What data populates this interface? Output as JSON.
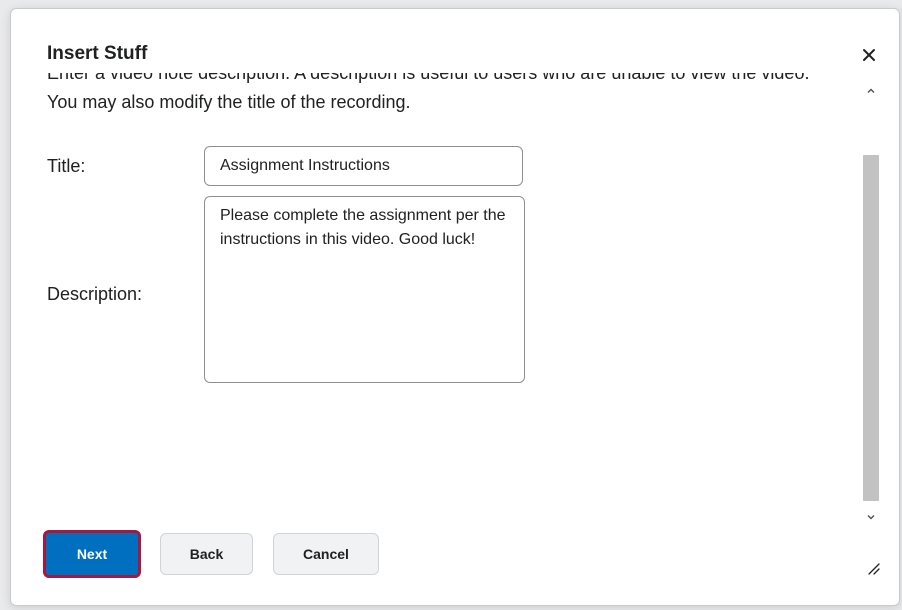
{
  "dialog": {
    "title": "Insert Stuff",
    "close_icon": "close-icon"
  },
  "content": {
    "intro_text": "Enter a video note description. A description is useful to users who are unable to view the video. You may also modify the title of the recording.",
    "title_label": "Title:",
    "title_value": "Assignment Instructions",
    "description_label": "Description:",
    "description_value": "Please complete the assignment per the instructions in this video. Good luck!"
  },
  "footer": {
    "next_label": "Next",
    "back_label": "Back",
    "cancel_label": "Cancel"
  },
  "icons": {
    "scroll_up": "chevron-up-icon",
    "scroll_down": "chevron-down-icon",
    "resize": "resize-grip-icon"
  },
  "colors": {
    "primary": "#006fbf",
    "focus_ring": "#a6193f",
    "text": "#202122"
  }
}
